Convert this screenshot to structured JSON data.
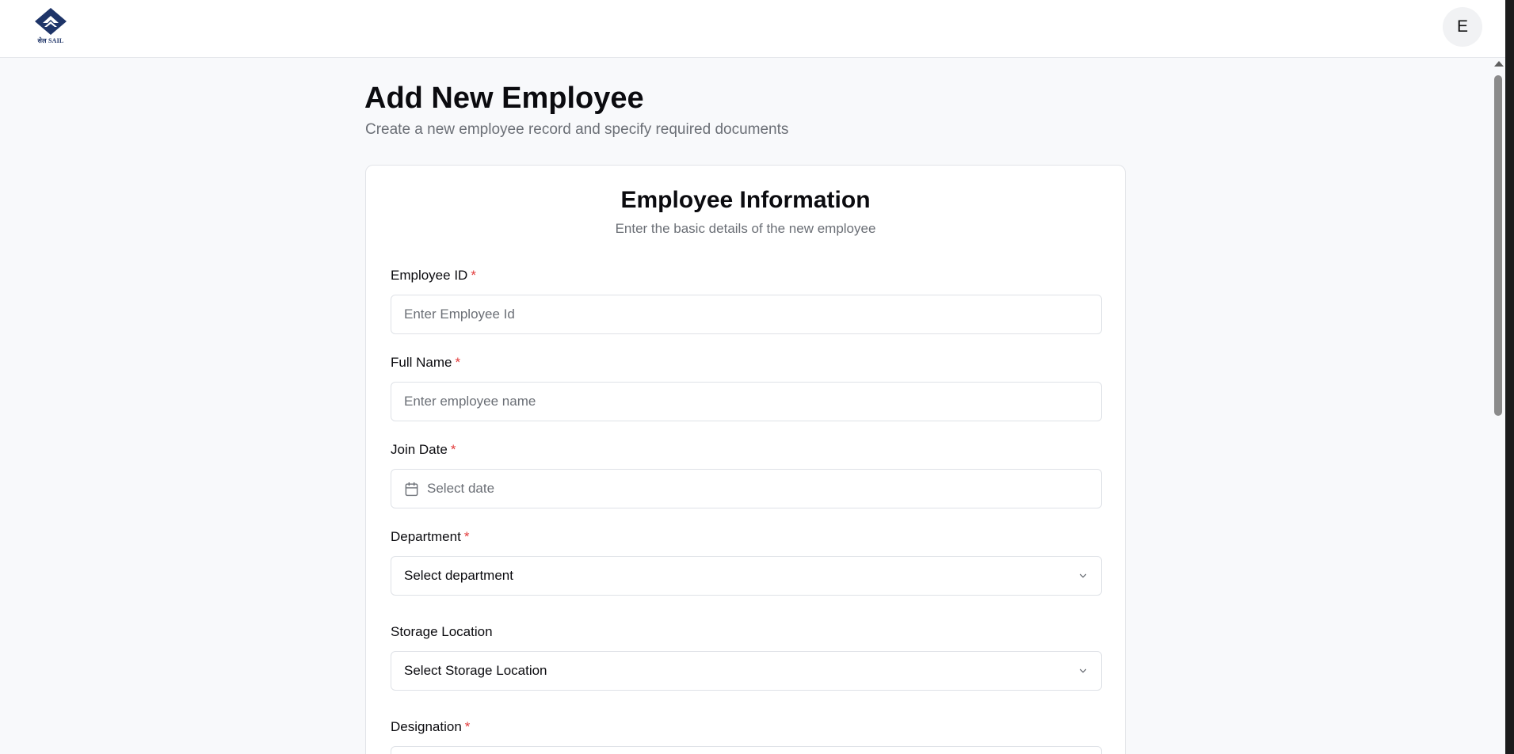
{
  "header": {
    "logo_text": "सेल SAIL",
    "avatar_initial": "E"
  },
  "page": {
    "title": "Add New Employee",
    "subtitle": "Create a new employee record and specify required documents"
  },
  "card": {
    "title": "Employee Information",
    "subtitle": "Enter the basic details of the new employee"
  },
  "form": {
    "employee_id": {
      "label": "Employee ID",
      "required_mark": "*",
      "placeholder": "Enter Employee Id",
      "value": ""
    },
    "full_name": {
      "label": "Full Name",
      "required_mark": "*",
      "placeholder": "Enter employee name",
      "value": ""
    },
    "join_date": {
      "label": "Join Date",
      "required_mark": "*",
      "placeholder": "Select date",
      "icon": "calendar-icon"
    },
    "department": {
      "label": "Department",
      "required_mark": "*",
      "selected": "Select department",
      "icon": "chevron-down-icon"
    },
    "storage_location": {
      "label": "Storage Location",
      "selected": "Select Storage Location",
      "icon": "chevron-down-icon"
    },
    "designation": {
      "label": "Designation",
      "required_mark": "*"
    }
  },
  "colors": {
    "brand": "#1e3468",
    "required": "#e23b3b",
    "muted_text": "#6b6f76",
    "background": "#f8f9fb",
    "border": "#dfe2e7"
  }
}
